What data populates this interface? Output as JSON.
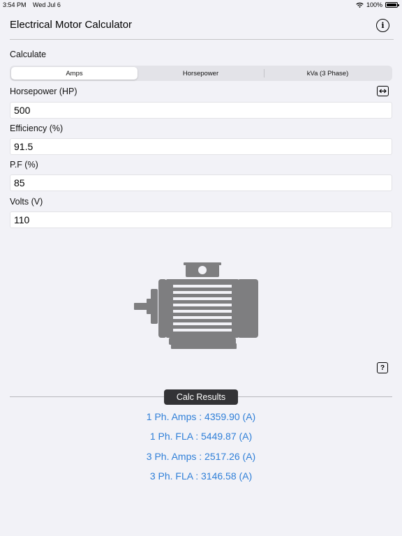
{
  "status_bar": {
    "time": "3:54 PM",
    "date": "Wed Jul 6",
    "battery_percent": "100%",
    "wifi_icon": "wifi-icon",
    "battery_icon": "battery-icon"
  },
  "header": {
    "title": "Electrical Motor Calculator",
    "info_icon": "info-circle-icon"
  },
  "calculate": {
    "label": "Calculate",
    "segments": [
      {
        "label": "Amps",
        "selected": true
      },
      {
        "label": "Horsepower",
        "selected": false
      },
      {
        "label": "kVa (3 Phase)",
        "selected": false
      }
    ],
    "swap_icon": "swap-horizontal-icon"
  },
  "fields": {
    "horsepower": {
      "label": "Horsepower (HP)",
      "value": "500"
    },
    "efficiency": {
      "label": "Efficiency (%)",
      "value": "91.5"
    },
    "power_factor": {
      "label": "P.F (%)",
      "value": "85"
    },
    "volts": {
      "label": "Volts (V)",
      "value": "110"
    }
  },
  "illustration": {
    "icon": "electric-motor-icon"
  },
  "help_icon": "question-mark-icon",
  "results": {
    "badge": "Calc Results",
    "lines": [
      "1 Ph. Amps : 4359.90 (A)",
      "1 Ph. FLA : 5449.87 (A)",
      "3 Ph. Amps : 2517.26 (A)",
      "3 Ph. FLA : 3146.58 (A)"
    ]
  },
  "colors": {
    "background": "#f2f2f7",
    "accent_blue": "#2f7fd8",
    "badge_bg": "#333336",
    "motor_gray": "#7e7e80"
  }
}
